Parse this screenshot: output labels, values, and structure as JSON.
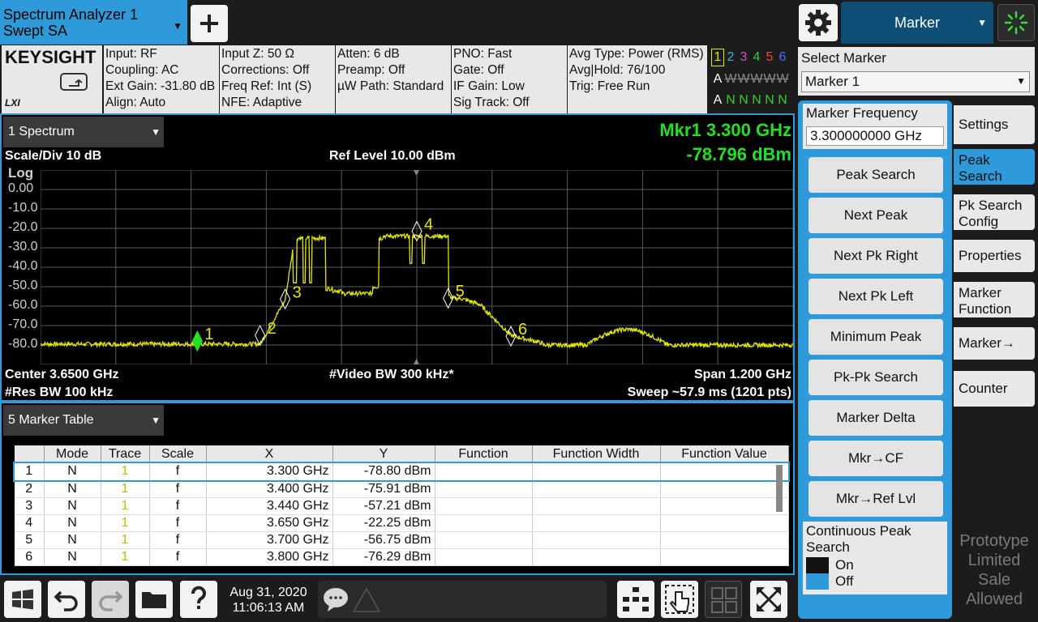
{
  "screen_tab": {
    "line1": "Spectrum Analyzer 1",
    "line2": "Swept SA"
  },
  "top_menu": {
    "label": "Marker"
  },
  "settings": {
    "logo": "KEYSIGHT",
    "lxi": "LXI",
    "col1": [
      "Input: RF",
      "Coupling: AC",
      "Ext Gain: -31.80 dB",
      "Align: Auto"
    ],
    "col2": [
      "Input Z: 50 Ω",
      "Corrections: Off",
      "Freq Ref: Int (S)",
      "NFE: Adaptive"
    ],
    "col3": [
      "Atten: 6 dB",
      "Preamp: Off",
      "µW Path: Standard"
    ],
    "col4": [
      "PNO: Fast",
      "Gate: Off",
      "IF Gain: Low",
      "Sig Track: Off"
    ],
    "col5": [
      "Avg Type: Power (RMS)",
      "Avg|Hold: 76/100",
      "Trig: Free Run"
    ],
    "trace_numbers": [
      "1",
      "2",
      "3",
      "4",
      "5",
      "6"
    ],
    "trace_colors": [
      "#e6e600",
      "#33b5e5",
      "#d050d0",
      "#33cc33",
      "#ff4040",
      "#4a6cff"
    ],
    "trace_type_row": [
      "A",
      "W",
      "W",
      "W",
      "W",
      "W"
    ],
    "trace_det_row": [
      "A",
      "N",
      "N",
      "N",
      "N",
      "N"
    ]
  },
  "spectrum": {
    "window_label": "1 Spectrum",
    "mkr_line1": "Mkr1  3.300 GHz",
    "mkr_line2": "-78.796 dBm",
    "scale_div": "Scale/Div 10 dB",
    "ref_level": "Ref Level 10.00 dBm",
    "scale_type": "Log",
    "yticks": [
      "0.00",
      "-10.0",
      "-20.0",
      "-30.0",
      "-40.0",
      "-50.0",
      "-60.0",
      "-70.0",
      "-80.0"
    ],
    "center": "Center 3.6500 GHz",
    "video_bw": "#Video BW 300 kHz*",
    "span": "Span 1.200 GHz",
    "res_bw": "#Res BW 100 kHz",
    "sweep": "Sweep ~57.9 ms  (1201 pts)",
    "marker_labels": [
      "1",
      "2",
      "3",
      "4",
      "5",
      "6"
    ],
    "trace_color": "#e6e600",
    "active_marker_color": "#22e022"
  },
  "marker_table": {
    "window_label": "5 Marker Table",
    "headers": [
      "",
      "Mode",
      "Trace",
      "Scale",
      "X",
      "Y",
      "Function",
      "Function Width",
      "Function Value"
    ],
    "rows": [
      [
        "1",
        "N",
        "1",
        "f",
        "3.300 GHz",
        "-78.80 dBm",
        "",
        "",
        ""
      ],
      [
        "2",
        "N",
        "1",
        "f",
        "3.400 GHz",
        "-75.91 dBm",
        "",
        "",
        ""
      ],
      [
        "3",
        "N",
        "1",
        "f",
        "3.440 GHz",
        "-57.21 dBm",
        "",
        "",
        ""
      ],
      [
        "4",
        "N",
        "1",
        "f",
        "3.650 GHz",
        "-22.25 dBm",
        "",
        "",
        ""
      ],
      [
        "5",
        "N",
        "1",
        "f",
        "3.700 GHz",
        "-56.75 dBm",
        "",
        "",
        ""
      ],
      [
        "6",
        "N",
        "1",
        "f",
        "3.800 GHz",
        "-76.29 dBm",
        "",
        "",
        ""
      ]
    ]
  },
  "softpanel": {
    "select_marker_label": "Select Marker",
    "select_marker_value": "Marker 1",
    "marker_freq_label": "Marker Frequency",
    "marker_freq_value": "3.300000000 GHz",
    "keys": [
      "Peak Search",
      "Next Peak",
      "Next Pk Right",
      "Next Pk Left",
      "Minimum Peak",
      "Pk-Pk Search",
      "Marker Delta",
      "Mkr→CF",
      "Mkr→Ref Lvl"
    ],
    "cont_peak_label": "Continuous Peak Search",
    "cont_on": "On",
    "cont_off": "Off",
    "menu_tabs": [
      "Settings",
      "Peak Search",
      "Pk Search Config",
      "Properties",
      "Marker Function",
      "Marker→",
      "Counter"
    ],
    "watermark": "Prototype Limited Sale Allowed"
  },
  "bottom": {
    "date": "Aug 31, 2020",
    "time": "11:06:13 AM"
  }
}
